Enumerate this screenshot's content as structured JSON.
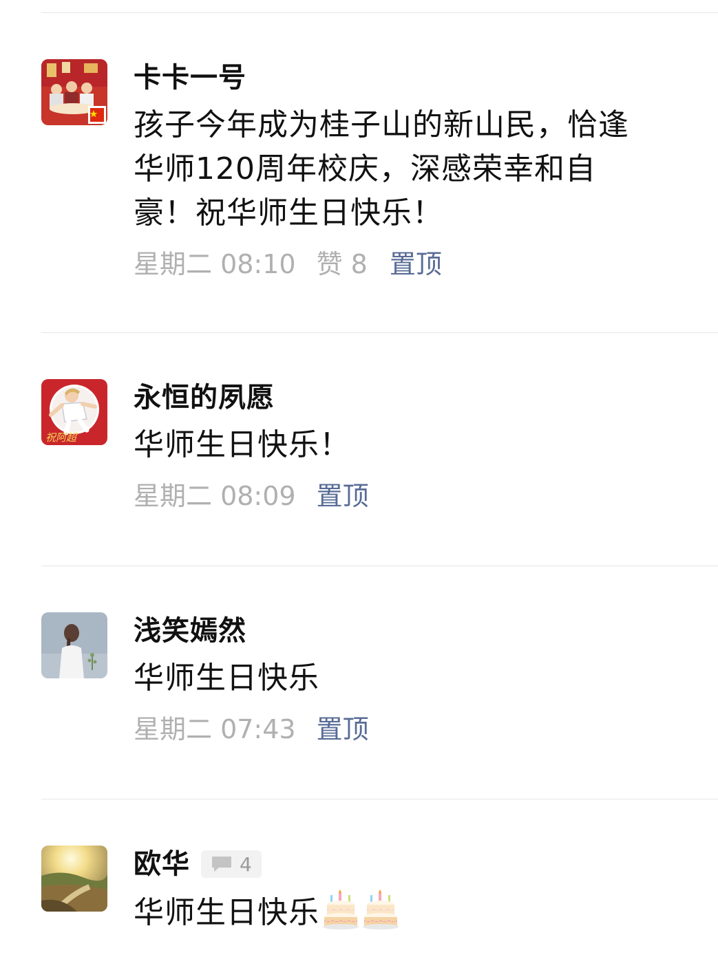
{
  "comments": [
    {
      "name": "卡卡一号",
      "text": "孩子今年成为桂子山的新山民，恰逢华师120周年校庆，深感荣幸和自豪！祝华师生日快乐！",
      "text_lines": [
        "孩子今年成为桂子山的新山民，恰逢",
        "华师120周年校庆，深感荣幸和自",
        "豪！祝华师生日快乐！"
      ],
      "time": "星期二 08:10",
      "likes": "赞 8",
      "pin": "置顶",
      "avatar": "family-dinner-avatar"
    },
    {
      "name": "永恒的夙愿",
      "text": "华师生日快乐！",
      "time": "星期二 08:09",
      "pin": "置顶",
      "avatar": "soccer-player-avatar"
    },
    {
      "name": "浅笑嫣然",
      "text": "华师生日快乐",
      "time": "星期二 07:43",
      "pin": "置顶",
      "avatar": "girl-back-avatar"
    },
    {
      "name": "欧华",
      "reply_count": "4",
      "text": "华师生日快乐",
      "emoji": [
        "birthday-cake-icon",
        "birthday-cake-icon"
      ],
      "avatar": "sunset-landscape-avatar"
    }
  ],
  "colors": {
    "name": "#111111",
    "text": "#111111",
    "time": "#b0b0b0",
    "pin": "#576b95",
    "divider": "#e6e6e6"
  }
}
